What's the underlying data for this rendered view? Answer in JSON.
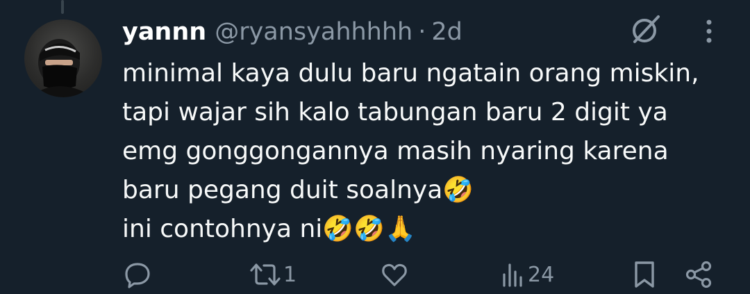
{
  "tweet": {
    "display_name": "yannn",
    "handle": "@ryansyahhhhh",
    "separator": "·",
    "timestamp": "2d",
    "text_lines": [
      "minimal kaya dulu baru ngatain orang miskin,",
      "tapi wajar sih kalo tabungan baru 2 digit ya",
      "emg gonggongannya masih nyaring karena",
      "baru pegang duit soalnya🤣",
      "ini contohnya ni🤣🤣🙏"
    ]
  },
  "actions": {
    "reply_count": "",
    "retweet_count": "1",
    "like_count": "",
    "views_count": "24"
  },
  "icons": [
    "grok-icon",
    "more-options-icon",
    "reply-icon",
    "retweet-icon",
    "like-icon",
    "views-icon",
    "bookmark-icon",
    "share-icon"
  ],
  "colors": {
    "background": "#15202b",
    "text": "#f7f9f9",
    "muted": "#8b98a5"
  }
}
